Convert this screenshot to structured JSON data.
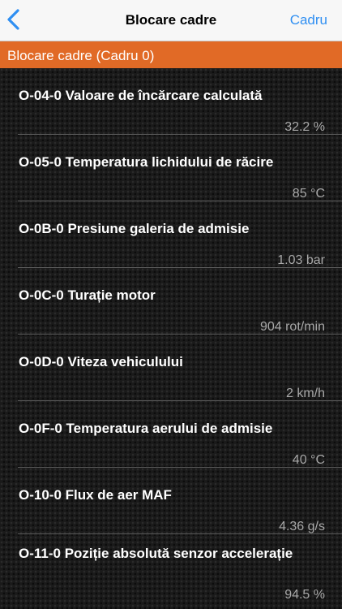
{
  "nav": {
    "title": "Blocare cadre",
    "right_button": "Cadru",
    "back_icon": "chevron-left-icon"
  },
  "section": {
    "title": "Blocare cadre (Cadru 0)"
  },
  "rows": [
    {
      "label": "O-04-0 Valoare de încărcare calculată",
      "value": "32.2 %"
    },
    {
      "label": "O-05-0 Temperatura lichidului de răcire",
      "value": "85 °C"
    },
    {
      "label": "O-0B-0 Presiune galeria de admisie",
      "value": "1.03 bar"
    },
    {
      "label": "O-0C-0 Turație motor",
      "value": "904 rot/min"
    },
    {
      "label": "O-0D-0 Viteza vehiculului",
      "value": "2 km/h"
    },
    {
      "label": "O-0F-0 Temperatura aerului de admisie",
      "value": "40 °C"
    },
    {
      "label": "O-10-0 Flux de aer MAF",
      "value": "4.36 g/s"
    },
    {
      "label": "O-11-0 Poziție absolută senzor accelerație",
      "value": "94.5 %"
    }
  ],
  "colors": {
    "accent": "#e16a26",
    "link": "#2f8ff2"
  }
}
